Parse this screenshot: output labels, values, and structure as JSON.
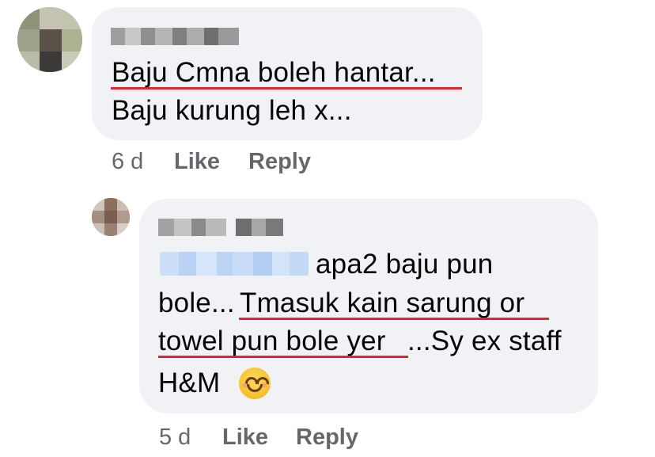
{
  "comment": {
    "text_lines": [
      "Baju Cmna boleh hantar...",
      "Baju kurung leh x..."
    ],
    "time": "6 d",
    "like_label": "Like",
    "reply_label": "Reply"
  },
  "reply": {
    "text_line_1": "apa2 baju pun",
    "text_line_2_a": "bole...",
    "text_line_2_b": "Tmasuk kain sarung or",
    "text_line_3_a": "towel pun bole yer",
    "text_line_3_b": "...Sy ex staff",
    "text_line_4": "H&M",
    "emoji": "smiling-face-emoji",
    "time": "5 d",
    "like_label": "Like",
    "reply_label": "Reply"
  },
  "colors": {
    "bubble": "#f0f2f5",
    "meta_text": "#65676b",
    "underline": "#e0262f",
    "mention_blur": "#c9dcf7"
  }
}
